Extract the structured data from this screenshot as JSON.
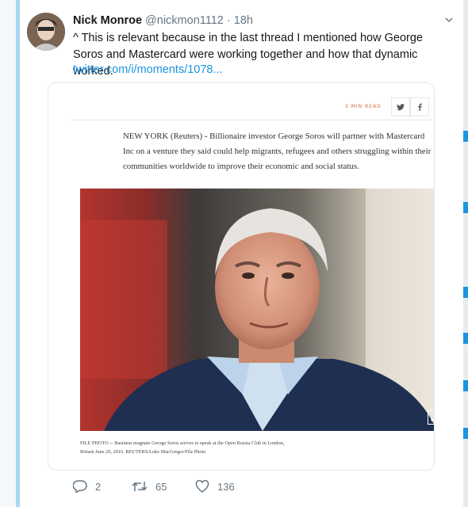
{
  "tweet": {
    "author_name": "Nick Monroe",
    "handle": "@nickmon1112",
    "separator": "·",
    "time": "18h",
    "text": "^ This is relevant because in the last thread I mentioned how George Soros and Mastercard were working together and how that dynamic worked.",
    "link": "twitter.com/i/moments/1078..."
  },
  "card": {
    "read_time": "3 MIN READ",
    "article_text": "NEW YORK (Reuters) - Billionaire investor George Soros will partner with Mastercard Inc on a venture they said could help migrants, refugees and others struggling within their communities worldwide to improve their economic and social status.",
    "caption_line1": "FILE PHOTO -- Business magnate George Soros arrives to speak at the Open Russia Club in London,",
    "caption_line2": "Britain June 20, 2016. REUTERS/Luke MacGregor/File Photo"
  },
  "actions": {
    "replies": "2",
    "retweets": "65",
    "likes": "136"
  },
  "icons": {
    "caret": "chevron-down-icon",
    "reply": "reply-icon",
    "retweet": "retweet-icon",
    "like": "heart-icon",
    "twitter_share": "twitter-share-icon",
    "facebook_share": "facebook-share-icon",
    "expand": "expand-icon"
  },
  "colors": {
    "link": "#1b95e0",
    "muted": "#657786",
    "thread_bar": "#a7d8f0"
  }
}
